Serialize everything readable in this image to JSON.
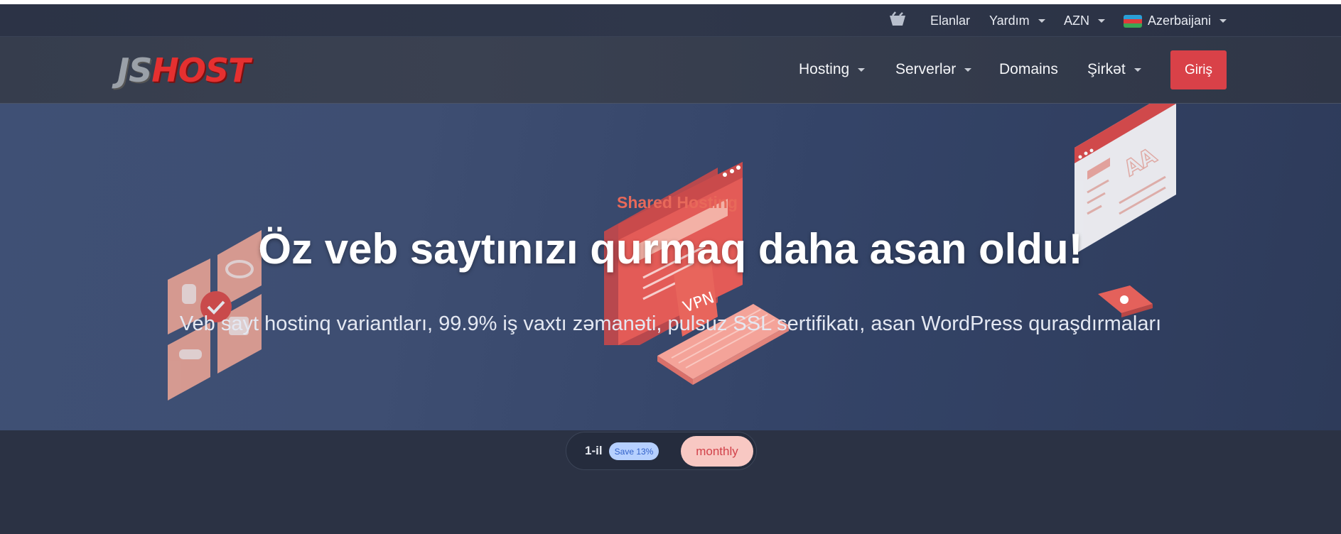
{
  "brand": {
    "logo_left": "JS",
    "logo_right": "HOST"
  },
  "utility_bar": {
    "announcements": "Elanlar",
    "help": "Yardım",
    "currency": "AZN",
    "language": "Azerbaijani",
    "icons": {
      "cart": "basket-icon",
      "flag": "azerbaijan-flag-icon"
    }
  },
  "nav": {
    "items": [
      {
        "label": "Hosting",
        "has_dropdown": true
      },
      {
        "label": "Serverlər",
        "has_dropdown": true
      },
      {
        "label": "Domains",
        "has_dropdown": false
      },
      {
        "label": "Şirkət",
        "has_dropdown": true
      }
    ],
    "login": "Giriş"
  },
  "hero": {
    "eyebrow": "Shared Hosting",
    "title": "Öz veb saytınızı qurmaq daha asan oldu!",
    "subtitle": "Veb sayt hostinq variantları, 99.9% iş vaxtı zəmanəti, pulsuz SSL sertifikatı, asan WordPress quraşdırmaları",
    "illustration_text": "VPN"
  },
  "billing": {
    "yearly_label": "1-il",
    "save_badge": "Save 13%",
    "monthly_label": "monthly",
    "selected": "monthly"
  },
  "colors": {
    "accent": "#d94148",
    "hero_bg": "#3e4e72",
    "eyebrow": "#e8695a",
    "badge_bg": "#b6d0ff",
    "monthly_bg": "#f8c8c3"
  }
}
